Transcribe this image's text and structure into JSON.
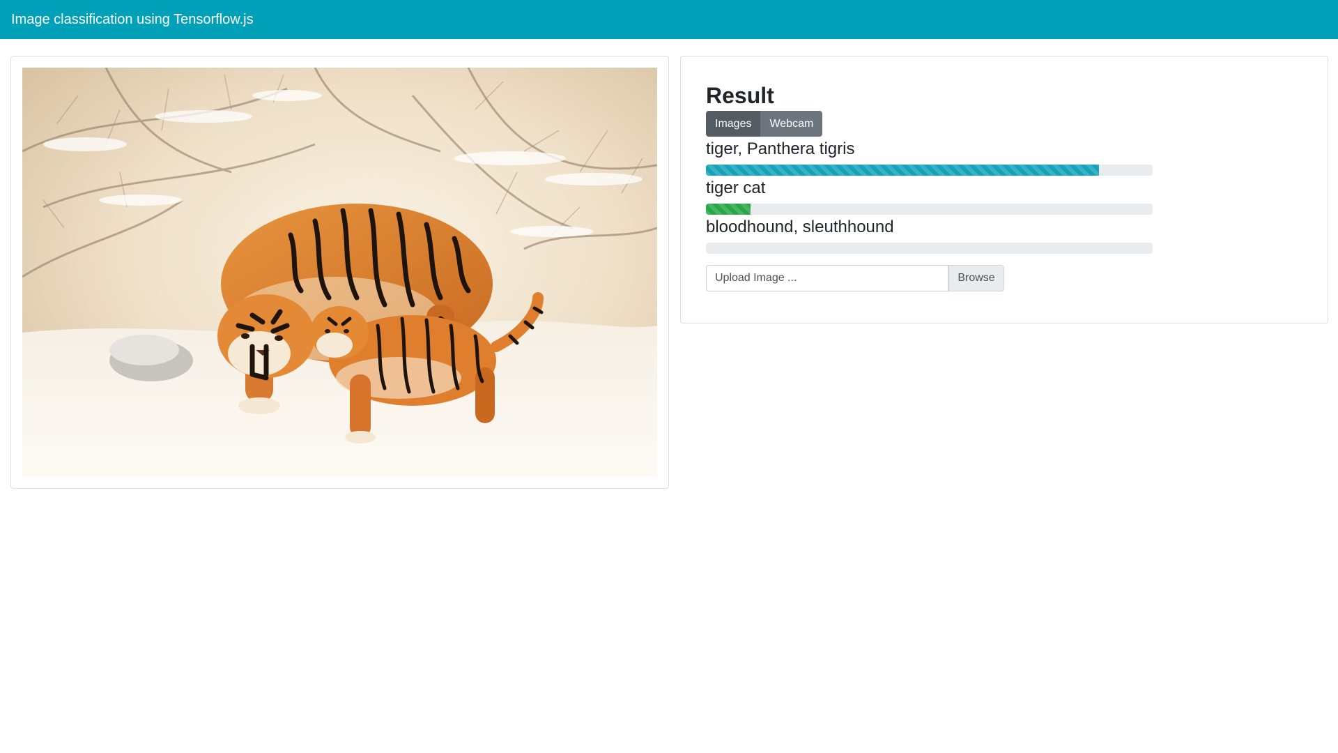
{
  "navbar": {
    "brand": "Image classification using Tensorflow.js"
  },
  "image_panel": {
    "subject": "tiger-with-cub-in-snow"
  },
  "result": {
    "title": "Result",
    "tabs": [
      {
        "label": "Images",
        "active": true
      },
      {
        "label": "Webcam",
        "active": false
      }
    ],
    "predictions": [
      {
        "label": "tiger, Panthera tigris",
        "probability": 0.88,
        "style": "info",
        "color": "#17a2b8"
      },
      {
        "label": "tiger cat",
        "probability": 0.1,
        "style": "success",
        "color": "#28a745"
      },
      {
        "label": "bloodhound, sleuthhound",
        "probability": 0.0,
        "style": "warning",
        "color": "#ffc107"
      }
    ],
    "upload": {
      "placeholder": "Upload Image ...",
      "button_label": "Browse"
    }
  },
  "colors": {
    "navbar": "#00a0b8",
    "button_dark": "#545b62",
    "button_secondary": "#6c757d"
  }
}
